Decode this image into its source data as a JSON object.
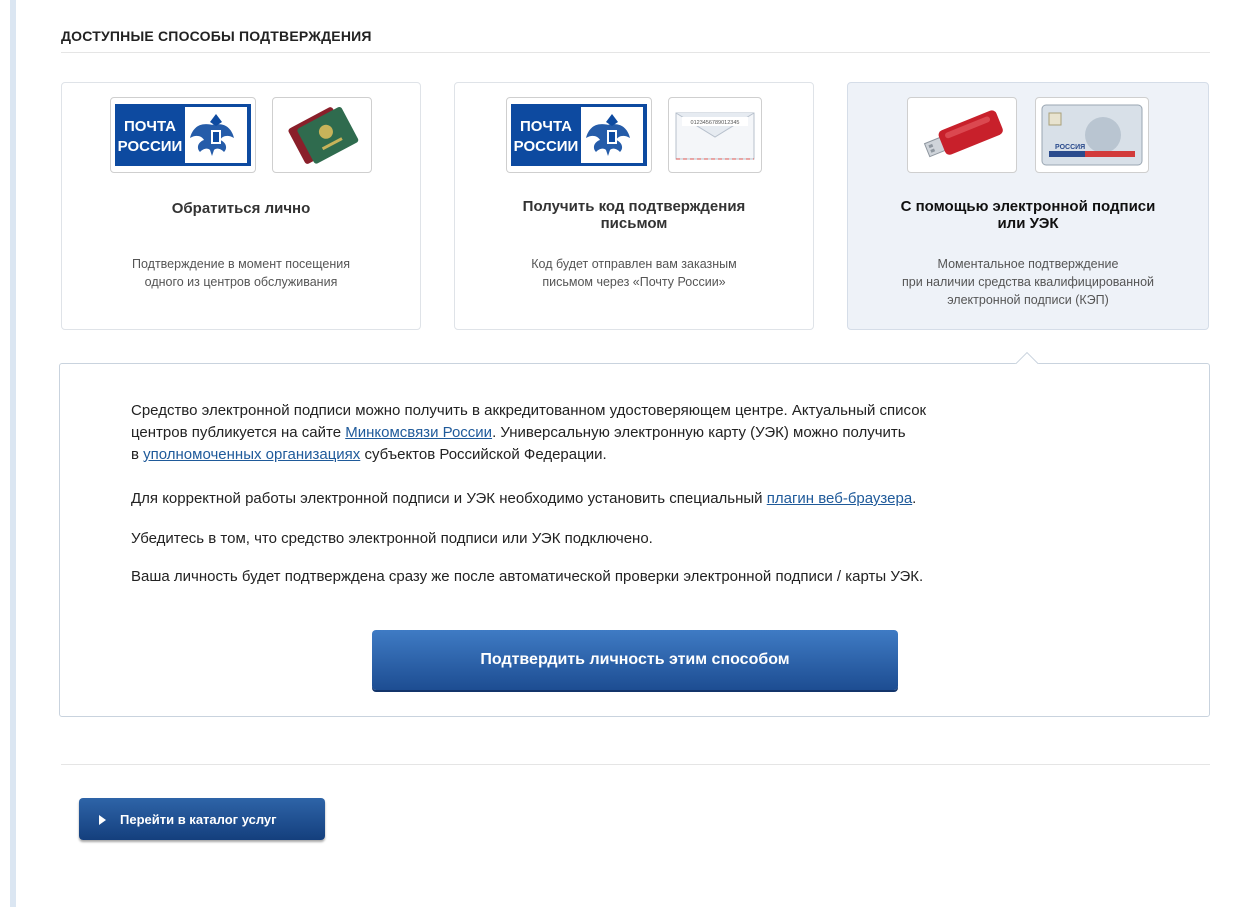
{
  "section": {
    "title": "ДОСТУПНЫЕ СПОСОБЫ ПОДТВЕРЖДЕНИЯ"
  },
  "cards": [
    {
      "title": "Обратиться лично",
      "desc_lines": [
        "Подтверждение в момент посещения",
        "одного из центров обслуживания"
      ],
      "logo_line1": "ПОЧТА",
      "logo_line2": "РОССИИ"
    },
    {
      "title_lines": [
        "Получить код подтверждения",
        "письмом"
      ],
      "desc_lines": [
        "Код будет отправлен вам заказным",
        "письмом через «Почту России»"
      ],
      "logo_line1": "ПОЧТА",
      "logo_line2": "РОССИИ",
      "envelope_code": "0123456789012345"
    },
    {
      "title_lines": [
        "С помощью электронной подписи",
        "или УЭК"
      ],
      "desc_lines": [
        "Моментальное подтверждение",
        "при наличии средства квалифицированной",
        "электронной подписи (КЭП)"
      ],
      "uek_card_text": "РОССИЯ"
    }
  ],
  "panel": {
    "p1": {
      "t1": "Средство электронной подписи можно получить в аккредитованном удостоверяющем центре. Актуальный список",
      "t2": "центров публикуется на сайте ",
      "link1": "Минкомсвязи России",
      "t3": ". Универсальную электронную карту (УЭК) можно получить",
      "t4": "в ",
      "link2": "уполномоченных организациях",
      "t5": " субъектов Российской Федерации."
    },
    "p2": {
      "t1": "Для корректной работы электронной подписи и УЭК необходимо установить специальный ",
      "link": "плагин веб-браузера",
      "t2": "."
    },
    "p3": "Убедитесь в том, что средство электронной подписи или УЭК подключено.",
    "p4": "Ваша личность будет подтверждена сразу же после автоматической проверки электронной подписи / карты УЭК.",
    "confirm_button": "Подтвердить личность этим способом"
  },
  "footer": {
    "catalog_button": "Перейти в каталог услуг"
  },
  "colors": {
    "accent": "#1d4d92",
    "link": "#1f5a9a",
    "active_card_bg": "#eef2f8"
  }
}
